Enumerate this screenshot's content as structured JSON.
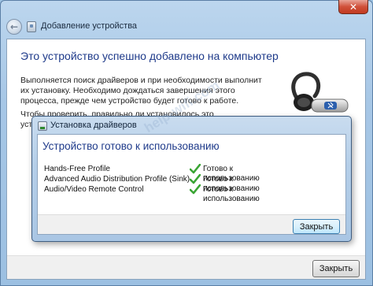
{
  "outer_window": {
    "title": "Добавление устройства",
    "heading": "Это устройство успешно добавлено на компьютер",
    "body_text": "Выполняется поиск драйверов и при необходимости выполнит их установку. Необходимо дождаться завершения этого процесса, прежде чем устройство будет готово к работе.",
    "body_text_2": "Чтобы проверить, правильно ли установилось это устройство,",
    "close_button": "Закрыть",
    "close_glyph": "✕",
    "back_glyph": "←"
  },
  "watermark": "help-wifi.com",
  "driver_dialog": {
    "title": "Установка драйверов",
    "heading": "Устройство готово к использованию",
    "profiles": [
      {
        "name": "Hands-Free Profile",
        "status": "Готово к использованию"
      },
      {
        "name": "Advanced Audio Distribution Profile (Sink)",
        "status": "Готово к использованию"
      },
      {
        "name": "Audio/Video Remote Control",
        "status": "Готово к использованию"
      }
    ],
    "close_button": "Закрыть"
  },
  "icons": {
    "back": "back-arrow-icon",
    "window": "device-window-icon",
    "device": "bluetooth-headset-icon",
    "check": "green-checkmark-icon"
  },
  "colors": {
    "heading": "#1e3a8a",
    "check": "#3aa534",
    "close_button_red": "#c13a20"
  }
}
